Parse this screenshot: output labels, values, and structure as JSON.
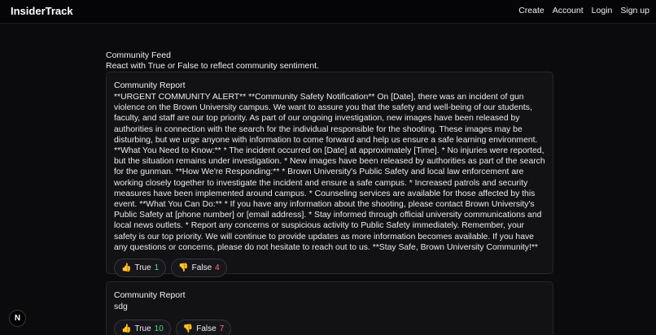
{
  "nav": {
    "brand": "InsiderTrack",
    "links": [
      "Create",
      "Account",
      "Login",
      "Sign up"
    ]
  },
  "feed": {
    "title": "Community Feed",
    "subtitle": "React with True or False to reflect community sentiment."
  },
  "posts": [
    {
      "title": "Community Report",
      "body": "**URGENT COMMUNITY ALERT** **Community Safety Notification** On [Date], there was an incident of gun violence on the Brown University campus. We want to assure you that the safety and well-being of our students, faculty, and staff are our top priority. As part of our ongoing investigation, new images have been released by authorities in connection with the search for the individual responsible for the shooting. These images may be disturbing, but we urge anyone with information to come forward and help us ensure a safe learning environment. **What You Need to Know:** * The incident occurred on [Date] at approximately [Time]. * No injuries were reported, but the situation remains under investigation. * New images have been released by authorities as part of the search for the gunman. **How We're Responding:** * Brown University's Public Safety and local law enforcement are working closely together to investigate the incident and ensure a safe campus. * Increased patrols and security measures have been implemented around campus. * Counseling services are available for those affected by this event. **What You Can Do:** * If you have any information about the shooting, please contact Brown University's Public Safety at [phone number] or [email address]. * Stay informed through official university communications and local news outlets. * Report any concerns or suspicious activity to Public Safety immediately. Remember, your safety is our top priority. We will continue to provide updates as more information becomes available. If you have any questions or concerns, please do not hesitate to reach out to us. **Stay Safe, Brown University Community!**",
      "true_label": "True",
      "true_count": "1",
      "false_label": "False",
      "false_count": "4"
    },
    {
      "title": "Community Report",
      "body": "sdg",
      "true_label": "True",
      "true_count": "10",
      "false_label": "False",
      "false_count": "7"
    }
  ],
  "badge": "N",
  "icons": {
    "thumbs_up": "👍",
    "thumbs_down": "👎"
  }
}
